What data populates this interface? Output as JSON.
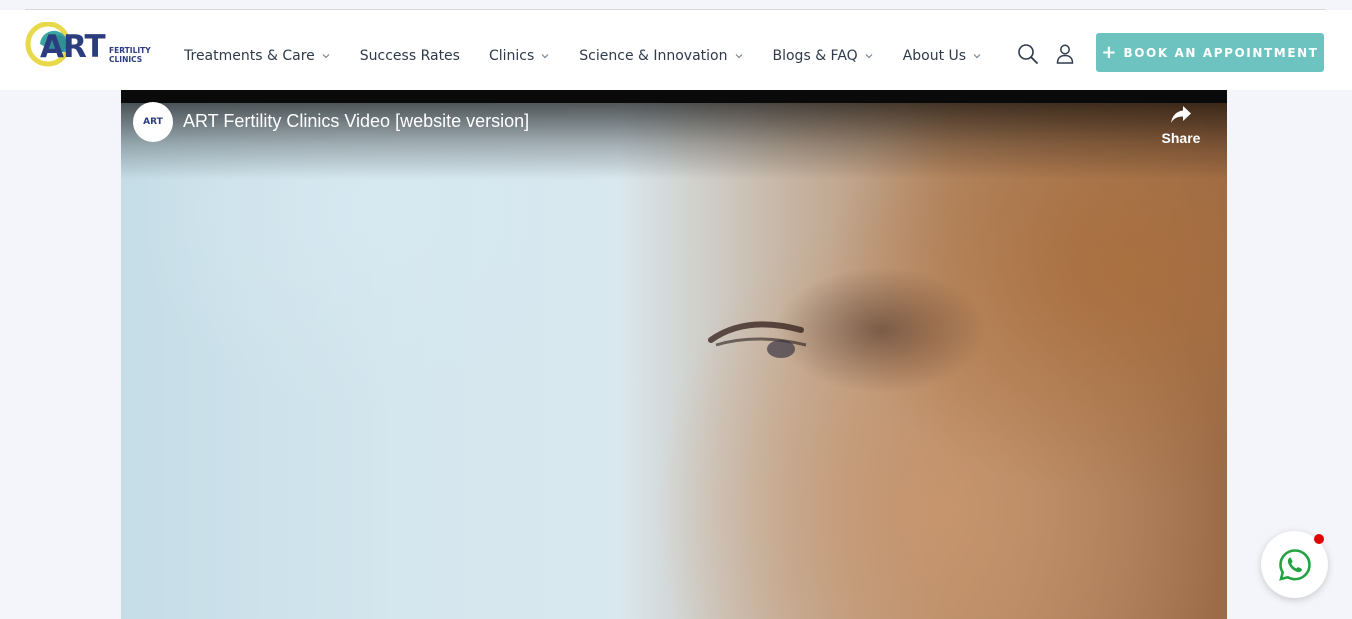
{
  "header": {
    "logo": {
      "brand": "ART",
      "sub_line1": "FERTILITY",
      "sub_line2": "CLINICS"
    },
    "nav": [
      {
        "label": "Treatments & Care",
        "has_dropdown": true
      },
      {
        "label": "Success Rates",
        "has_dropdown": false
      },
      {
        "label": "Clinics",
        "has_dropdown": true
      },
      {
        "label": "Science & Innovation",
        "has_dropdown": true
      },
      {
        "label": "Blogs & FAQ",
        "has_dropdown": true
      },
      {
        "label": "About Us",
        "has_dropdown": true
      }
    ],
    "icons": [
      "search-icon",
      "user-icon"
    ],
    "cta": {
      "icon": "+",
      "label": "BOOK AN APPOINTMENT"
    }
  },
  "video": {
    "channel_avatar": "ART",
    "title": "ART Fertility Clinics Video [website version]",
    "share_label": "Share"
  },
  "floating": {
    "whatsapp_icon": "whatsapp-icon",
    "notification": "red-dot"
  },
  "colors": {
    "brand_navy": "#2c3d7f",
    "cta_teal": "#6cc3bf",
    "logo_yellow": "#e8d94a",
    "logo_teal": "#3aa6a0",
    "whatsapp_green": "#25a244",
    "notification_red": "#e00000",
    "page_bg": "#f4f5fa"
  }
}
